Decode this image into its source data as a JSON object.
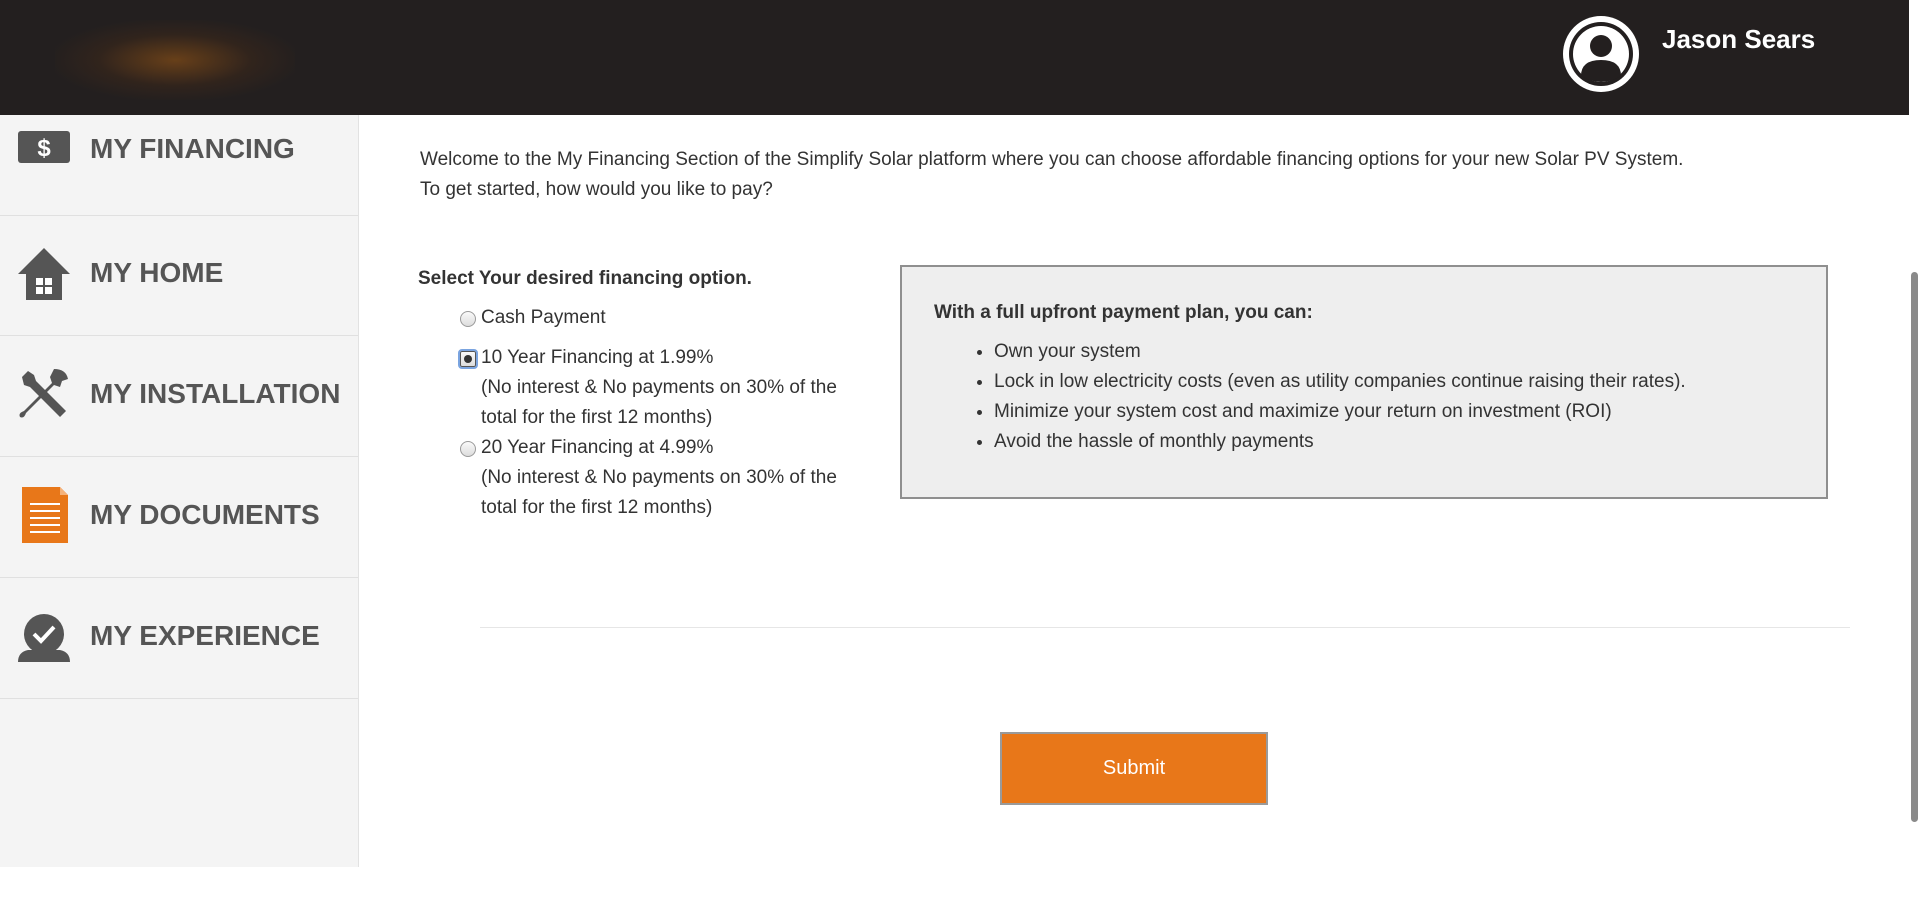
{
  "header": {
    "user_name": "Jason Sears",
    "avatar_icon": "user-avatar-icon",
    "background_color": "#231f1f"
  },
  "sidebar": {
    "items": [
      {
        "label": "MY FINANCING",
        "icon": "dollar-bill-icon"
      },
      {
        "label": "MY HOME",
        "icon": "house-icon"
      },
      {
        "label": "MY INSTALLATION",
        "icon": "tools-icon"
      },
      {
        "label": "MY DOCUMENTS",
        "icon": "document-icon"
      },
      {
        "label": "MY EXPERIENCE",
        "icon": "checkmark-badge-icon"
      }
    ]
  },
  "main": {
    "intro_line1": "Welcome to the My Financing Section of the Simplify Solar platform where you can choose affordable financing options for your new Solar PV System.",
    "intro_line2": "To get started, how would you like to pay?",
    "select_heading": "Select Your desired financing option.",
    "options": [
      {
        "label": "Cash Payment",
        "note": "",
        "selected": false
      },
      {
        "label": "10 Year Financing at 1.99%",
        "note": "(No interest & No payments on 30% of the total for the first 12 months)",
        "selected": true
      },
      {
        "label": "20 Year Financing at 4.99%",
        "note": "(No interest & No payments on 30% of the total for the first 12 months)",
        "selected": false
      }
    ],
    "info_box": {
      "heading": "With a full upfront payment plan, you can:",
      "bullets": [
        "Own your system",
        "Lock in low electricity costs (even as utility companies continue raising their rates).",
        "Minimize your system cost and maximize your return on investment (ROI)",
        "Avoid the hassle of monthly payments"
      ]
    },
    "submit_label": "Submit"
  },
  "colors": {
    "accent": "#e87719",
    "sidebar_background": "#f4f4f4",
    "sidebar_text": "#555555",
    "orange_icon": "#e87719"
  }
}
